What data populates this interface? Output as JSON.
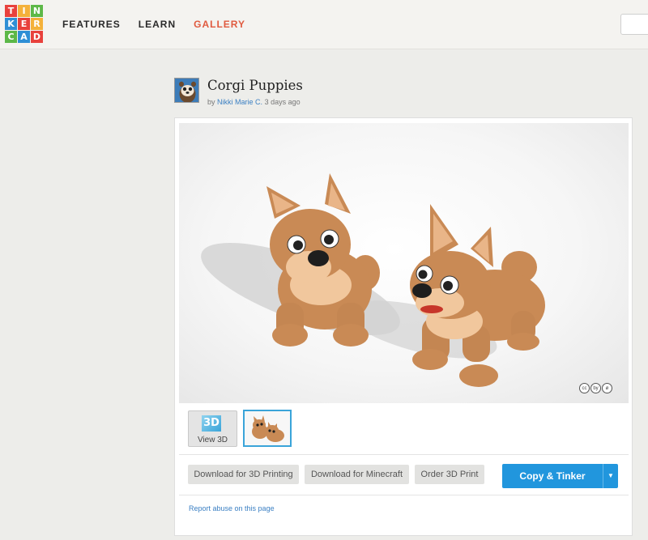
{
  "logo": {
    "letters": [
      "T",
      "I",
      "N",
      "K",
      "E",
      "R",
      "C",
      "A",
      "D"
    ],
    "colors": [
      "#e8413c",
      "#f4b13a",
      "#5db848",
      "#2f8fd5",
      "#e8413c",
      "#f4b13a",
      "#5db848",
      "#2f8fd5",
      "#e8413c"
    ]
  },
  "nav": {
    "items": [
      {
        "label": "FEATURES"
      },
      {
        "label": "LEARN"
      },
      {
        "label": "GALLERY",
        "active": true
      }
    ]
  },
  "design": {
    "title": "Corgi Puppies",
    "by_prefix": "by",
    "author": "Nikki Marie C.",
    "time": "3 days ago"
  },
  "viewer": {
    "license_icons": [
      "cc",
      "by",
      "ø"
    ]
  },
  "thumbnails": {
    "view3d_badge": "3D",
    "view3d_label": "View 3D"
  },
  "actions": {
    "download_3d_printing": "Download for 3D Printing",
    "download_minecraft": "Download for Minecraft",
    "order_3d_print": "Order 3D Print",
    "copy_tinker": "Copy & Tinker",
    "caret": "▼"
  },
  "footer": {
    "report": "Report abuse on this page"
  },
  "colors": {
    "accent_blue": "#2196dd",
    "nav_active": "#e05a3f",
    "link": "#3a7fc3",
    "corgi_body": "#c98a55",
    "corgi_light": "#f1c79d"
  }
}
